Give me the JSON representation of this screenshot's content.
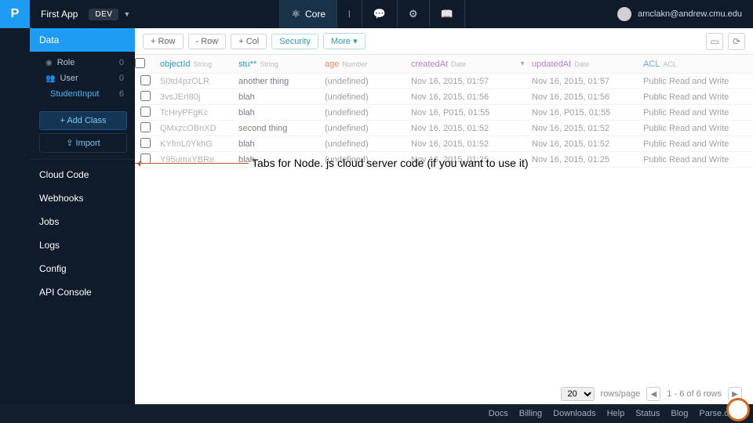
{
  "header": {
    "app_name": "First App",
    "env_badge": "DEV",
    "core_label": "Core",
    "user_email": "amclakn@andrew.cmu.edu"
  },
  "sidebar": {
    "sections": {
      "data": "Data",
      "cloud_code": "Cloud Code",
      "webhooks": "Webhooks",
      "jobs": "Jobs",
      "logs": "Logs",
      "config": "Config",
      "api_console": "API Console"
    },
    "classes": [
      {
        "icon": "●",
        "name": "Role",
        "count": "0"
      },
      {
        "icon": "👥",
        "name": "User",
        "count": "0"
      },
      {
        "icon": "",
        "name": "StudentInput",
        "count": "6"
      }
    ],
    "add_class": "+  Add Class",
    "import": "⇪ Import"
  },
  "toolbar": {
    "add_row": "+ Row",
    "del_row": "- Row",
    "add_col": "+ Col",
    "security": "Security",
    "more": "More ▾"
  },
  "columns": [
    {
      "key": "objectId",
      "label": "objectId",
      "type": "String"
    },
    {
      "key": "stuff",
      "label": "stu**",
      "type": "String"
    },
    {
      "key": "age",
      "label": "age",
      "type": "Number"
    },
    {
      "key": "createdAt",
      "label": "createdAt",
      "type": "Date"
    },
    {
      "key": "updatedAt",
      "label": "updatedAt",
      "type": "Date"
    },
    {
      "key": "ACL",
      "label": "ACL",
      "type": "ACL"
    }
  ],
  "rows": [
    {
      "objectId": "S0td4pzOLR",
      "stuff": "another thing",
      "age": "(undefined)",
      "createdAt": "Nov 16, 2015, 01:57",
      "updatedAt": "Nov 16, 2015, 01:57",
      "ACL": "Public Read and Write"
    },
    {
      "objectId": "3vsJErI80j",
      "stuff": "blah",
      "age": "(undefined)",
      "createdAt": "Nov 16, 2015, 01:56",
      "updatedAt": "Nov 16, 2015, 01:56",
      "ACL": "Public Read and Write"
    },
    {
      "objectId": "TcHryPFgKc",
      "stuff": "blah",
      "age": "(undefined)",
      "createdAt": "Nov 16, P015, 01:55",
      "updatedAt": "Nov 16, P015, 01:55",
      "ACL": "Public Read and Write"
    },
    {
      "objectId": "QMxzcOBnXD",
      "stuff": "second thing",
      "age": "(undefined)",
      "createdAt": "Nov 16, 2015, 01:52",
      "updatedAt": "Nov 16, 2015, 01:52",
      "ACL": "Public Read and Write"
    },
    {
      "objectId": "KYfmL0YkhG",
      "stuff": "blah",
      "age": "(undefined)",
      "createdAt": "Nov 16, 2015, 01:52",
      "updatedAt": "Nov 16, 2015, 01:52",
      "ACL": "Public Read and Write"
    },
    {
      "objectId": "Y95umxYBRe",
      "stuff": "blah",
      "age": "(undefined)",
      "createdAt": "Nov 16, 2015, 01:25",
      "updatedAt": "Nov 16, 2015, 01:25",
      "ACL": "Public Read and Write"
    }
  ],
  "annotation": "Tabs for Node. js cloud server code (if you want to use it)",
  "pager": {
    "per_page": "20",
    "per_page_label": "rows/page",
    "range": "1 - 6 of 6 rows"
  },
  "footer": [
    "Docs",
    "Billing",
    "Downloads",
    "Help",
    "Status",
    "Blog",
    "Parse.com"
  ]
}
